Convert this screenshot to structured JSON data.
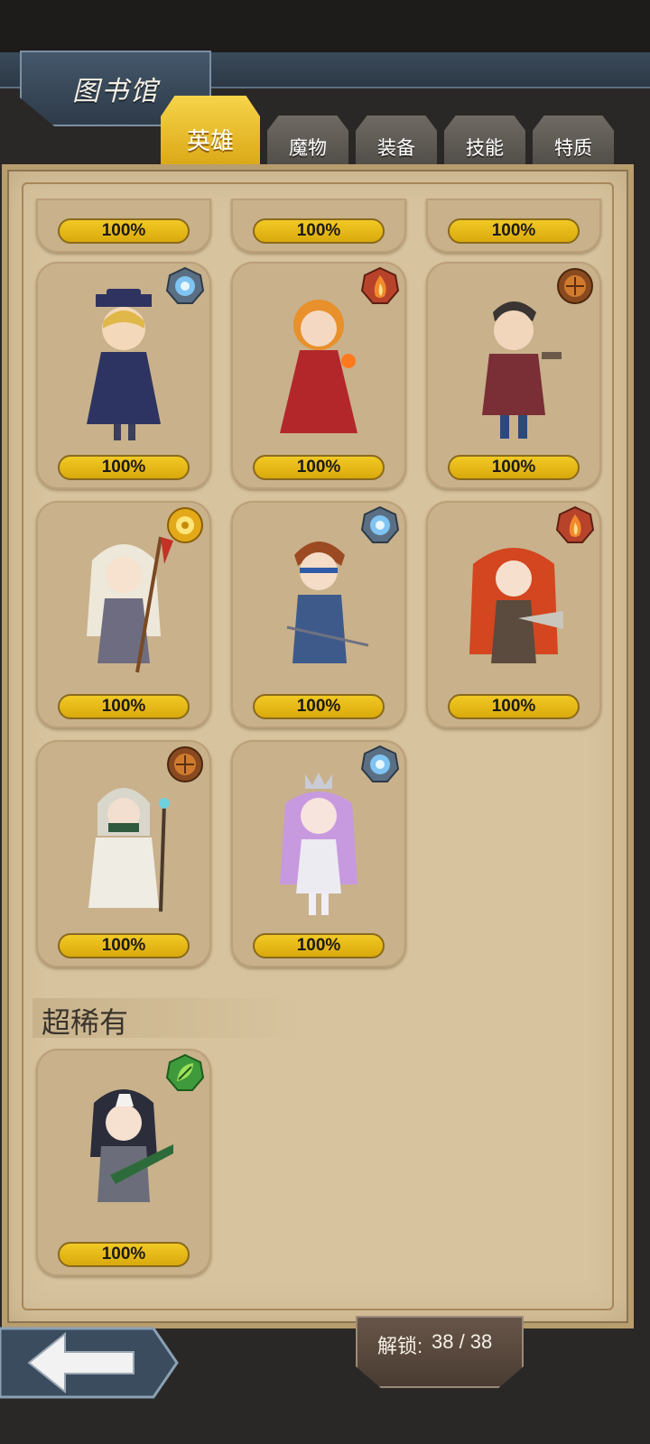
{
  "header": {
    "title": "图书馆"
  },
  "tabs": [
    {
      "label": "英雄",
      "active": true
    },
    {
      "label": "魔物",
      "active": false
    },
    {
      "label": "装备",
      "active": false
    },
    {
      "label": "技能",
      "active": false
    },
    {
      "label": "特质",
      "active": false
    }
  ],
  "cards_partial_row": [
    "100%",
    "100%",
    "100%"
  ],
  "heroes": [
    {
      "progress": "100%",
      "element": "water-icon"
    },
    {
      "progress": "100%",
      "element": "fire-icon"
    },
    {
      "progress": "100%",
      "element": "earth-icon"
    },
    {
      "progress": "100%",
      "element": "light-icon"
    },
    {
      "progress": "100%",
      "element": "water-icon"
    },
    {
      "progress": "100%",
      "element": "fire-icon"
    },
    {
      "progress": "100%",
      "element": "earth-icon"
    },
    {
      "progress": "100%",
      "element": "water-icon"
    }
  ],
  "section": {
    "title": "超稀有"
  },
  "super_rare": [
    {
      "progress": "100%",
      "element": "nature-icon"
    }
  ],
  "footer": {
    "unlock_label": "解锁:",
    "unlock_value": "38 / 38"
  },
  "colors": {
    "panel": "#d7c39d",
    "card": "#c8b18b",
    "progress_fill": "#f2c925",
    "tab_active": "#f6d44a",
    "tab_inactive": "#5f5a54"
  }
}
